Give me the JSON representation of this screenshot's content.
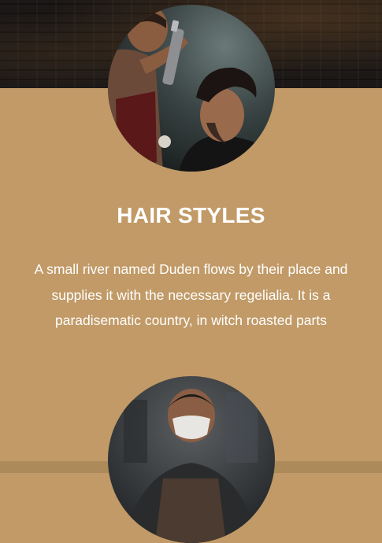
{
  "service": {
    "title": "HAIR STYLES",
    "description": "A small river named Duden flows by their place and supplies it with the necessary regelialia. It is a paradisematic country, in witch roasted parts"
  },
  "colors": {
    "section_background": "#c19a67",
    "text": "#ffffff",
    "header_background": "#0f0c0b"
  },
  "images": {
    "primary": "barber-styling-hair-photo",
    "secondary": "barber-with-mask-photo"
  }
}
